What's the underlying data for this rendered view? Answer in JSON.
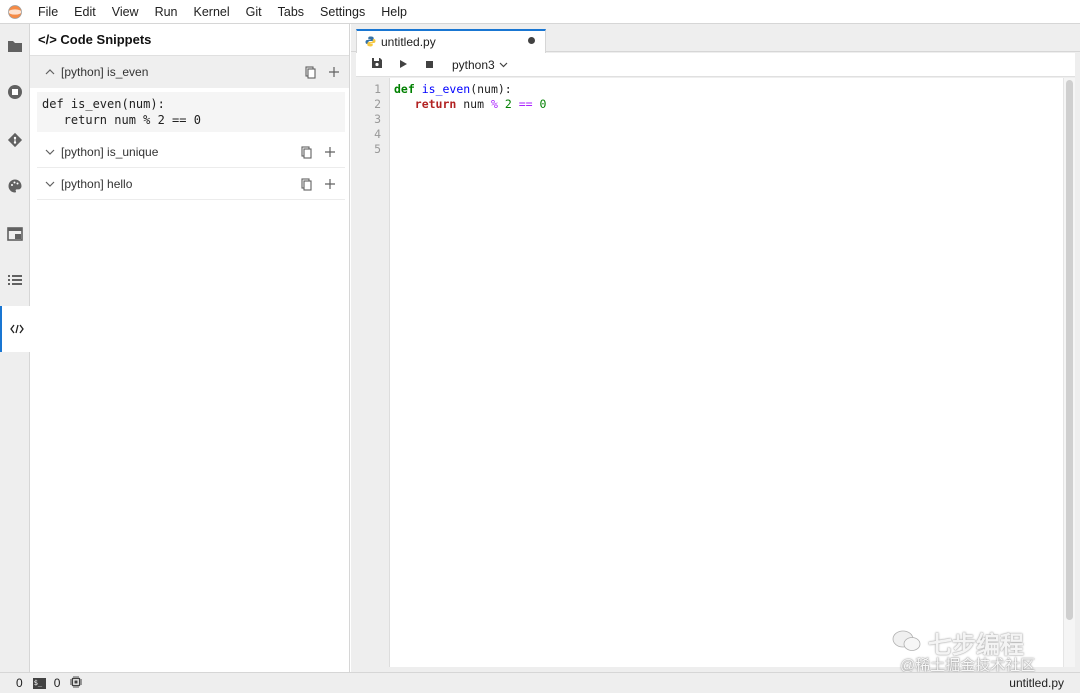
{
  "menubar": {
    "items": [
      "File",
      "Edit",
      "View",
      "Run",
      "Kernel",
      "Git",
      "Tabs",
      "Settings",
      "Help"
    ]
  },
  "rail": {
    "icons": [
      "folder-icon",
      "running-stop-icon",
      "git-icon",
      "palette-icon",
      "tab-window-icon",
      "table-of-contents-icon",
      "code-snippets-icon"
    ],
    "active": "code-snippets-icon"
  },
  "panel": {
    "title": "</> Code Snippets",
    "snippets": [
      {
        "label": "[python] is_even",
        "expanded": true,
        "code": "def is_even(num):\n   return num % 2 == 0"
      },
      {
        "label": "[python] is_unique",
        "expanded": false
      },
      {
        "label": "[python] hello",
        "expanded": false
      }
    ]
  },
  "editor": {
    "tab_title": "untitled.py",
    "dirty": true,
    "kernel": "python3",
    "line_numbers": [
      "1",
      "2",
      "3",
      "4",
      "5"
    ]
  },
  "statusbar": {
    "left_count_1": "0",
    "left_count_2": "0",
    "right_file": "untitled.py"
  },
  "watermark": {
    "main": "七步编程",
    "sub": "@稀土掘金技术社区"
  },
  "colors": {
    "accent": "#1976d2",
    "keyword": "#008000",
    "function": "#0000ff",
    "return_keyword": "#b22222",
    "operator": "#aa22ff"
  }
}
